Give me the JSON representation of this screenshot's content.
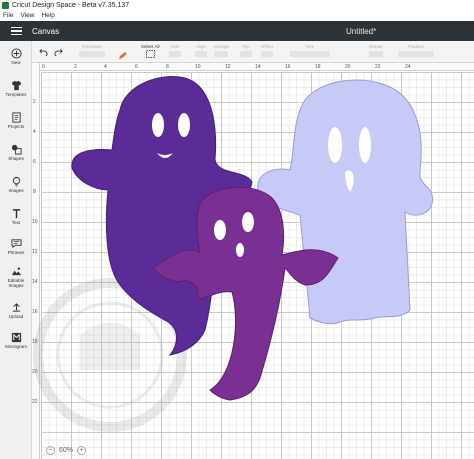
{
  "window": {
    "title": "Cricut Design Space - Beta v7.35.137"
  },
  "menu": [
    "File",
    "View",
    "Help"
  ],
  "header": {
    "section": "Canvas",
    "document_title": "Untitled*"
  },
  "toolbar": {
    "select_all": "Select All",
    "items": [
      "Operation",
      "Edit",
      "Align",
      "Arrange",
      "Flip",
      "Offset",
      "Size",
      "Rotate",
      "Position"
    ]
  },
  "sidebar": {
    "items": [
      {
        "label": "New",
        "icon": "plus-circle-icon"
      },
      {
        "label": "Templates",
        "icon": "shirt-icon"
      },
      {
        "label": "Projects",
        "icon": "folder-icon"
      },
      {
        "label": "Shapes",
        "icon": "shapes-icon"
      },
      {
        "label": "Images",
        "icon": "lightbulb-icon"
      },
      {
        "label": "Text",
        "icon": "text-icon"
      },
      {
        "label": "Phrases",
        "icon": "speech-bubble-icon"
      },
      {
        "label": "Editable Images",
        "icon": "editable-image-icon"
      },
      {
        "label": "Upload",
        "icon": "upload-icon"
      },
      {
        "label": "Monogram",
        "icon": "monogram-icon"
      }
    ]
  },
  "rulers": {
    "top": [
      "0",
      "2",
      "4",
      "6",
      "8",
      "10",
      "12",
      "14",
      "16",
      "18",
      "20",
      "22",
      "24"
    ],
    "left": [
      "2",
      "4",
      "6",
      "8",
      "10",
      "12",
      "14",
      "16",
      "18",
      "20",
      "22"
    ]
  },
  "zoom": {
    "level": "60%"
  },
  "colors": {
    "header_bg": "#2e3338",
    "ghost_dark_purple": "#5b2c97",
    "ghost_magenta_purple": "#7a2f93",
    "ghost_lavender": "#c7c9f6"
  }
}
